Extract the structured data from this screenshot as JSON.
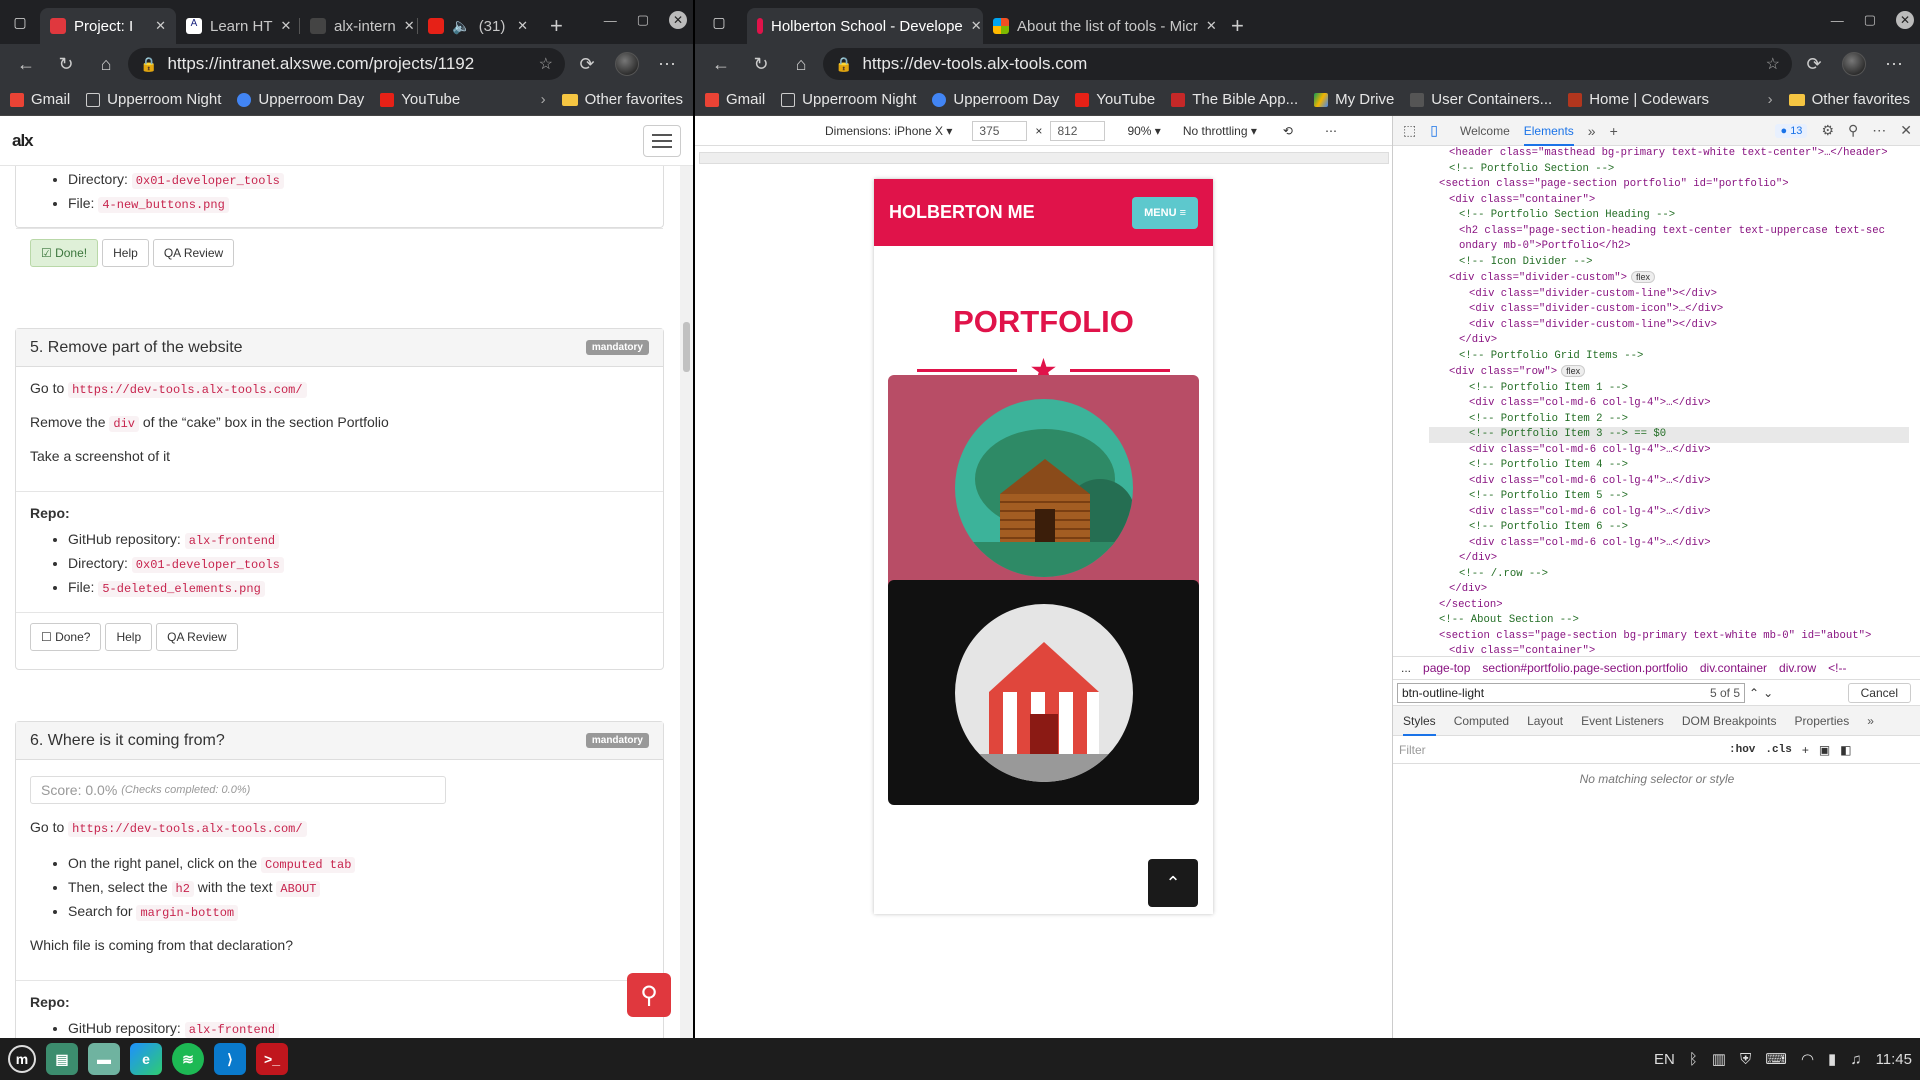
{
  "left_browser": {
    "tabs": [
      {
        "label": "Project: I",
        "active": true
      },
      {
        "label": "Learn HT",
        "active": false
      },
      {
        "label": "alx-intern",
        "active": false
      },
      {
        "label": "(31)",
        "active": false
      }
    ],
    "url": "https://intranet.alxswe.com/projects/1192",
    "bookmarks": [
      "Gmail",
      "Upperroom Night",
      "Upperroom Day",
      "YouTube"
    ],
    "other_favorites": "Other favorites"
  },
  "alx": {
    "logo": "alx",
    "task4_list": [
      {
        "label": "Directory: ",
        "code": "0x01-developer_tools"
      },
      {
        "label": "File: ",
        "code": "4-new_buttons.png"
      }
    ],
    "buttons_done": {
      "done": "Done!",
      "help": "Help",
      "qa": "QA Review"
    },
    "task5": {
      "title": "5. Remove part of the website",
      "badge": "mandatory",
      "goto": "Go to ",
      "url": "https://dev-tools.alx-tools.com/",
      "remove_pre": "Remove the ",
      "remove_code": "div",
      "remove_post": " of the “cake” box in the section Portfolio",
      "screenshot": "Take a screenshot of it",
      "repo_label": "Repo:",
      "repo": [
        {
          "label": "GitHub repository: ",
          "code": "alx-frontend"
        },
        {
          "label": "Directory: ",
          "code": "0x01-developer_tools"
        },
        {
          "label": "File: ",
          "code": "5-deleted_elements.png"
        }
      ],
      "buttons": {
        "done": "Done?",
        "help": "Help",
        "qa": "QA Review"
      }
    },
    "task6": {
      "title": "6. Where is it coming from?",
      "badge": "mandatory",
      "score": "Score: 0.0%",
      "score_detail": "(Checks completed: 0.0%)",
      "goto": "Go to ",
      "url": "https://dev-tools.alx-tools.com/",
      "steps": [
        {
          "pre": "On the right panel, click on the ",
          "code": "Computed tab",
          "post": ""
        },
        {
          "pre": "Then, select the ",
          "code": "h2",
          "mid": " with the text ",
          "code2": "ABOUT"
        },
        {
          "pre": "Search for ",
          "code": "margin-bottom",
          "post": ""
        }
      ],
      "question": "Which file is coming from that declaration?",
      "repo_label": "Repo:",
      "repo": [
        {
          "label": "GitHub repository: ",
          "code": "alx-frontend"
        }
      ]
    }
  },
  "right_browser": {
    "tabs": [
      {
        "label": "Holberton School - Develope",
        "active": true
      },
      {
        "label": "About the list of tools - Micr",
        "active": false
      }
    ],
    "url": "https://dev-tools.alx-tools.com",
    "bookmarks": [
      "Gmail",
      "Upperroom Night",
      "Upperroom Day",
      "YouTube",
      "The Bible App...",
      "My Drive",
      "User Containers...",
      "Home | Codewars"
    ],
    "other_favorites": "Other favorites"
  },
  "device_toolbar": {
    "dimensions_label": "Dimensions: iPhone X",
    "width": "375",
    "height": "812",
    "times": "×",
    "zoom": "90%",
    "throttle": "No throttling"
  },
  "phone": {
    "brand": "HOLBERTON ME",
    "menu": "MENU ≡",
    "title": "PORTFOLIO"
  },
  "devtools": {
    "tabs": [
      "Welcome",
      "Elements"
    ],
    "issues": "13",
    "dom_lines": [
      {
        "kind": "raw",
        "text": "<header class=\"masthead bg-primary text-white text-center\">…</header>",
        "indent": 2
      },
      {
        "kind": "comment",
        "text": "<!-- Portfolio Section -->",
        "indent": 2
      },
      {
        "kind": "raw",
        "text": "<section class=\"page-section portfolio\" id=\"portfolio\">",
        "indent": 1
      },
      {
        "kind": "raw",
        "text": "<div class=\"container\">",
        "indent": 2
      },
      {
        "kind": "comment",
        "text": "<!-- Portfolio Section Heading -->",
        "indent": 3
      },
      {
        "kind": "raw",
        "text": "<h2 class=\"page-section-heading text-center text-uppercase text-sec",
        "indent": 3
      },
      {
        "kind": "raw",
        "text": "ondary mb-0\">Portfolio</h2>",
        "indent": 3
      },
      {
        "kind": "comment",
        "text": "<!-- Icon Divider -->",
        "indent": 3
      },
      {
        "kind": "raw",
        "text": "<div class=\"divider-custom\">",
        "indent": 2,
        "pill": "flex"
      },
      {
        "kind": "raw",
        "text": "<div class=\"divider-custom-line\"></div>",
        "indent": 4
      },
      {
        "kind": "raw",
        "text": "<div class=\"divider-custom-icon\">…</div>",
        "indent": 4
      },
      {
        "kind": "raw",
        "text": "<div class=\"divider-custom-line\"></div>",
        "indent": 4
      },
      {
        "kind": "raw",
        "text": "</div>",
        "indent": 3
      },
      {
        "kind": "comment",
        "text": "<!-- Portfolio Grid Items -->",
        "indent": 3
      },
      {
        "kind": "raw",
        "text": "<div class=\"row\">",
        "indent": 2,
        "pill": "flex"
      },
      {
        "kind": "comment",
        "text": "<!-- Portfolio Item 1 -->",
        "indent": 4
      },
      {
        "kind": "raw",
        "text": "<div class=\"col-md-6 col-lg-4\">…</div>",
        "indent": 4
      },
      {
        "kind": "comment",
        "text": "<!-- Portfolio Item 2 -->",
        "indent": 4
      },
      {
        "kind": "comment",
        "text": "<!-- Portfolio Item 3 --> == $0",
        "indent": 4,
        "highlight": true
      },
      {
        "kind": "raw",
        "text": "<div class=\"col-md-6 col-lg-4\">…</div>",
        "indent": 4
      },
      {
        "kind": "comment",
        "text": "<!-- Portfolio Item 4 -->",
        "indent": 4
      },
      {
        "kind": "raw",
        "text": "<div class=\"col-md-6 col-lg-4\">…</div>",
        "indent": 4
      },
      {
        "kind": "comment",
        "text": "<!-- Portfolio Item 5 -->",
        "indent": 4
      },
      {
        "kind": "raw",
        "text": "<div class=\"col-md-6 col-lg-4\">…</div>",
        "indent": 4
      },
      {
        "kind": "comment",
        "text": "<!-- Portfolio Item 6 -->",
        "indent": 4
      },
      {
        "kind": "raw",
        "text": "<div class=\"col-md-6 col-lg-4\">…</div>",
        "indent": 4
      },
      {
        "kind": "raw",
        "text": "</div>",
        "indent": 3
      },
      {
        "kind": "comment",
        "text": "<!-- /.row -->",
        "indent": 3
      },
      {
        "kind": "raw",
        "text": "</div>",
        "indent": 2
      },
      {
        "kind": "raw",
        "text": "</section>",
        "indent": 1
      },
      {
        "kind": "comment",
        "text": "<!-- About Section -->",
        "indent": 1
      },
      {
        "kind": "raw",
        "text": "<section class=\"page-section bg-primary text-white mb-0\" id=\"about\">",
        "indent": 1
      },
      {
        "kind": "raw",
        "text": "<div class=\"container\">",
        "indent": 2
      },
      {
        "kind": "comment",
        "text": "<!-- About Section Heading -->",
        "indent": 3
      }
    ],
    "breadcrumbs": [
      "...",
      "page-top",
      "section#portfolio.page-section.portfolio",
      "div.container",
      "div.row",
      "<!--"
    ],
    "search_value": "btn-outline-light",
    "search_count": "5 of 5",
    "cancel": "Cancel",
    "styles_tabs": [
      "Styles",
      "Computed",
      "Layout",
      "Event Listeners",
      "DOM Breakpoints",
      "Properties"
    ],
    "filter_placeholder": "Filter",
    "hov": ":hov",
    "cls": ".cls",
    "no_match": "No matching selector or style"
  },
  "taskbar": {
    "lang": "EN",
    "time": "11:45"
  }
}
